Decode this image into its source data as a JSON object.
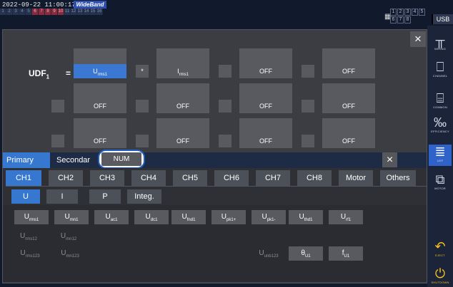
{
  "status": {
    "datetime": "2022-09-22 11:00:17",
    "mode": "WideBand",
    "usb": "USB",
    "channel_strip": [
      "1",
      "2",
      "3",
      "4",
      "5",
      "6",
      "7",
      "8",
      "9",
      "10",
      "11",
      "12",
      "13",
      "14",
      "15",
      "16"
    ],
    "ch_numbers": [
      "1",
      "2",
      "3",
      "4",
      "5",
      "6",
      "7",
      "8"
    ]
  },
  "sidebar": {
    "items": [
      {
        "label": "WIRING",
        "icon": "wiring-icon"
      },
      {
        "label": "CHANNEL",
        "icon": "channel-icon"
      },
      {
        "label": "COMMON",
        "icon": "common-icon"
      },
      {
        "label": "EFFICIENCY",
        "icon": "efficiency-icon"
      },
      {
        "label": "UDF",
        "icon": "udf-icon"
      },
      {
        "label": "MOTOR",
        "icon": "motor-icon"
      },
      {
        "label": "EJECT",
        "icon": "eject-icon"
      },
      {
        "label": "SHUTDOWN",
        "icon": "shutdown-icon"
      }
    ]
  },
  "udf": {
    "label_main": "UDF",
    "label_sub": "1",
    "equals": "=",
    "rows": [
      {
        "slots": [
          {
            "main": "U",
            "sub": "rms1",
            "selected": true
          },
          {
            "op": "*"
          },
          {
            "main": "I",
            "sub": "rms1"
          },
          {
            "op": ""
          },
          {
            "main": "OFF",
            "sub": ""
          },
          {
            "op": ""
          },
          {
            "main": "OFF",
            "sub": ""
          }
        ]
      },
      {
        "slots": [
          {
            "op": ""
          },
          {
            "main": "OFF",
            "sub": ""
          },
          {
            "op": ""
          },
          {
            "main": "OFF",
            "sub": ""
          },
          {
            "op": ""
          },
          {
            "main": "OFF",
            "sub": ""
          },
          {
            "op": ""
          },
          {
            "main": "OFF",
            "sub": ""
          }
        ]
      },
      {
        "slots": [
          {
            "op": ""
          },
          {
            "main": "OFF",
            "sub": ""
          },
          {
            "op": ""
          },
          {
            "main": "OFF",
            "sub": ""
          },
          {
            "op": ""
          },
          {
            "main": "OFF",
            "sub": ""
          },
          {
            "op": ""
          },
          {
            "main": "OFF",
            "sub": ""
          }
        ]
      }
    ]
  },
  "tabs": {
    "primary": "Primary",
    "secondary": "Secondar",
    "num": "NUM",
    "close": "×"
  },
  "channels": [
    "CH1",
    "CH2",
    "CH3",
    "CH4",
    "CH5",
    "CH6",
    "CH7",
    "CH8",
    "Motor",
    "Others"
  ],
  "quantities": [
    "U",
    "I",
    "P",
    "Integ."
  ],
  "params": {
    "row1": [
      {
        "main": "U",
        "sub": "rms1"
      },
      {
        "main": "U",
        "sub": "mn1"
      },
      {
        "main": "U",
        "sub": "ac1"
      },
      {
        "main": "U",
        "sub": "dc1"
      },
      {
        "main": "U",
        "sub": "fnd1"
      },
      {
        "main": "U",
        "sub": "pk1+"
      },
      {
        "main": "U",
        "sub": "pk1-"
      },
      {
        "main": "U",
        "sub": "thd1"
      },
      {
        "main": "U",
        "sub": "rf1"
      }
    ],
    "row2": [
      {
        "main": "U",
        "sub": "rms12"
      },
      {
        "main": "U",
        "sub": "mn12"
      }
    ],
    "row3_left": [
      {
        "main": "U",
        "sub": "rms123"
      },
      {
        "main": "U",
        "sub": "mn123"
      }
    ],
    "row3_right_label": {
      "main": "U",
      "sub": "unb123"
    },
    "row3_right": [
      {
        "main": "θ",
        "sub": "U1"
      },
      {
        "main": "f",
        "sub": "U1"
      }
    ]
  },
  "colors": {
    "accent": "#3678cf",
    "highlight_ring": "#1e5ec6",
    "warning": "#f3c21b"
  }
}
